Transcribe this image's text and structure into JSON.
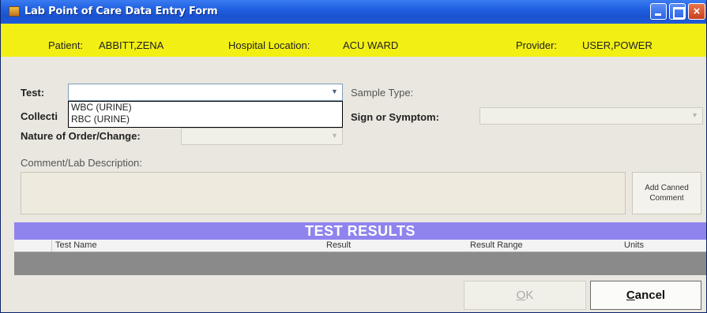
{
  "window": {
    "title": "Lab Point of Care Data Entry Form"
  },
  "patient_bar": {
    "patient_label": "Patient:",
    "patient_value": "ABBITT,ZENA",
    "location_label": "Hospital Location:",
    "location_value": "ACU WARD",
    "provider_label": "Provider:",
    "provider_value": "USER,POWER"
  },
  "form": {
    "test_label": "Test:",
    "test_value": "",
    "collect_label": "Collecti",
    "sample_type_label": "Sample Type:",
    "sign_symptom_label": "Sign or Symptom:",
    "nature_label": "Nature of Order/Change:",
    "comment_label": "Comment/Lab Description:",
    "add_canned_line1": "Add Canned",
    "add_canned_line2": "Comment"
  },
  "test_dropdown": {
    "options": [
      "WBC (URINE)",
      "RBC (URINE)"
    ]
  },
  "results": {
    "header": "TEST RESULTS",
    "columns": [
      "Test Name",
      "Result",
      "Result Range",
      "Units"
    ],
    "rows": []
  },
  "buttons": {
    "ok_mnemonic": "O",
    "ok_rest": "K",
    "cancel_mnemonic": "C",
    "cancel_rest": "ancel"
  },
  "colors": {
    "title_bar": "#1f5fe0",
    "patient_bar": "#f2ef15",
    "results_header": "#8f84ee",
    "window_bg": "#e9e7df"
  },
  "icons": [
    "app-icon",
    "minimize-icon",
    "maximize-icon",
    "close-icon",
    "chevron-down-icon"
  ]
}
